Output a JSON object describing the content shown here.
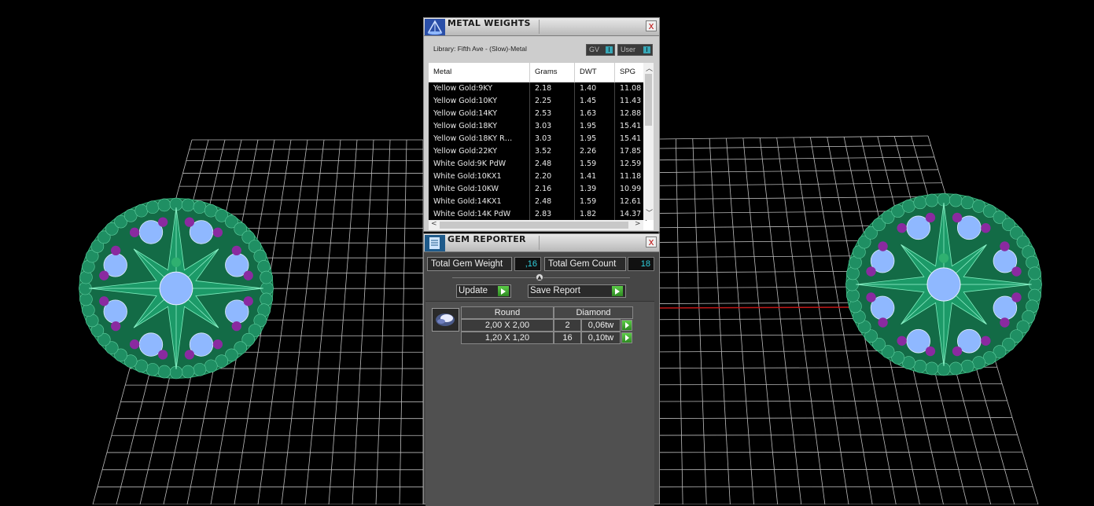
{
  "metal_weights": {
    "title": "METAL WEIGHTS",
    "library": "Library: Fifth Ave - (Slow)-Metal",
    "gv_label": "GV",
    "gv_indicator": "I",
    "user_label": "User",
    "user_indicator": "I",
    "close": "x",
    "columns": [
      "Metal",
      "Grams",
      "DWT",
      "SPG"
    ],
    "rows": [
      [
        "Yellow Gold:9KY",
        "2.18",
        "1.40",
        "11.08"
      ],
      [
        "Yellow Gold:10KY",
        "2.25",
        "1.45",
        "11.43"
      ],
      [
        "Yellow Gold:14KY",
        "2.53",
        "1.63",
        "12.88"
      ],
      [
        "Yellow Gold:18KY",
        "3.03",
        "1.95",
        "15.41"
      ],
      [
        "Yellow Gold:18KY R…",
        "3.03",
        "1.95",
        "15.41"
      ],
      [
        "Yellow Gold:22KY",
        "3.52",
        "2.26",
        "17.85"
      ],
      [
        "White Gold:9K PdW",
        "2.48",
        "1.59",
        "12.59"
      ],
      [
        "White Gold:10KX1",
        "2.20",
        "1.41",
        "11.18"
      ],
      [
        "White Gold:10KW",
        "2.16",
        "1.39",
        "10.99"
      ],
      [
        "White Gold:14KX1",
        "2.48",
        "1.59",
        "12.61"
      ],
      [
        "White Gold:14K PdW",
        "2.83",
        "1.82",
        "14.37"
      ]
    ]
  },
  "gem_reporter": {
    "title": "GEM REPORTER",
    "close": "x",
    "total_weight_label": "Total Gem Weight",
    "total_weight_value": ",16",
    "total_count_label": "Total Gem Count",
    "total_count_value": "18",
    "update_label": "Update",
    "save_report_label": "Save Report",
    "shape_header": "Round",
    "material_header": "Diamond",
    "gems": [
      {
        "size": "2,00 X 2,00",
        "count": "2",
        "weight": "0,06tw"
      },
      {
        "size": "1,20 X 1,20",
        "count": "16",
        "weight": "0,10tw"
      }
    ]
  },
  "colors": {
    "gem_green": "#1f8f63",
    "gem_blue": "#8fb8ff",
    "gem_purple": "#8a2aa0",
    "value_cyan": "#2fd2e0",
    "button_green": "#3cb030"
  }
}
